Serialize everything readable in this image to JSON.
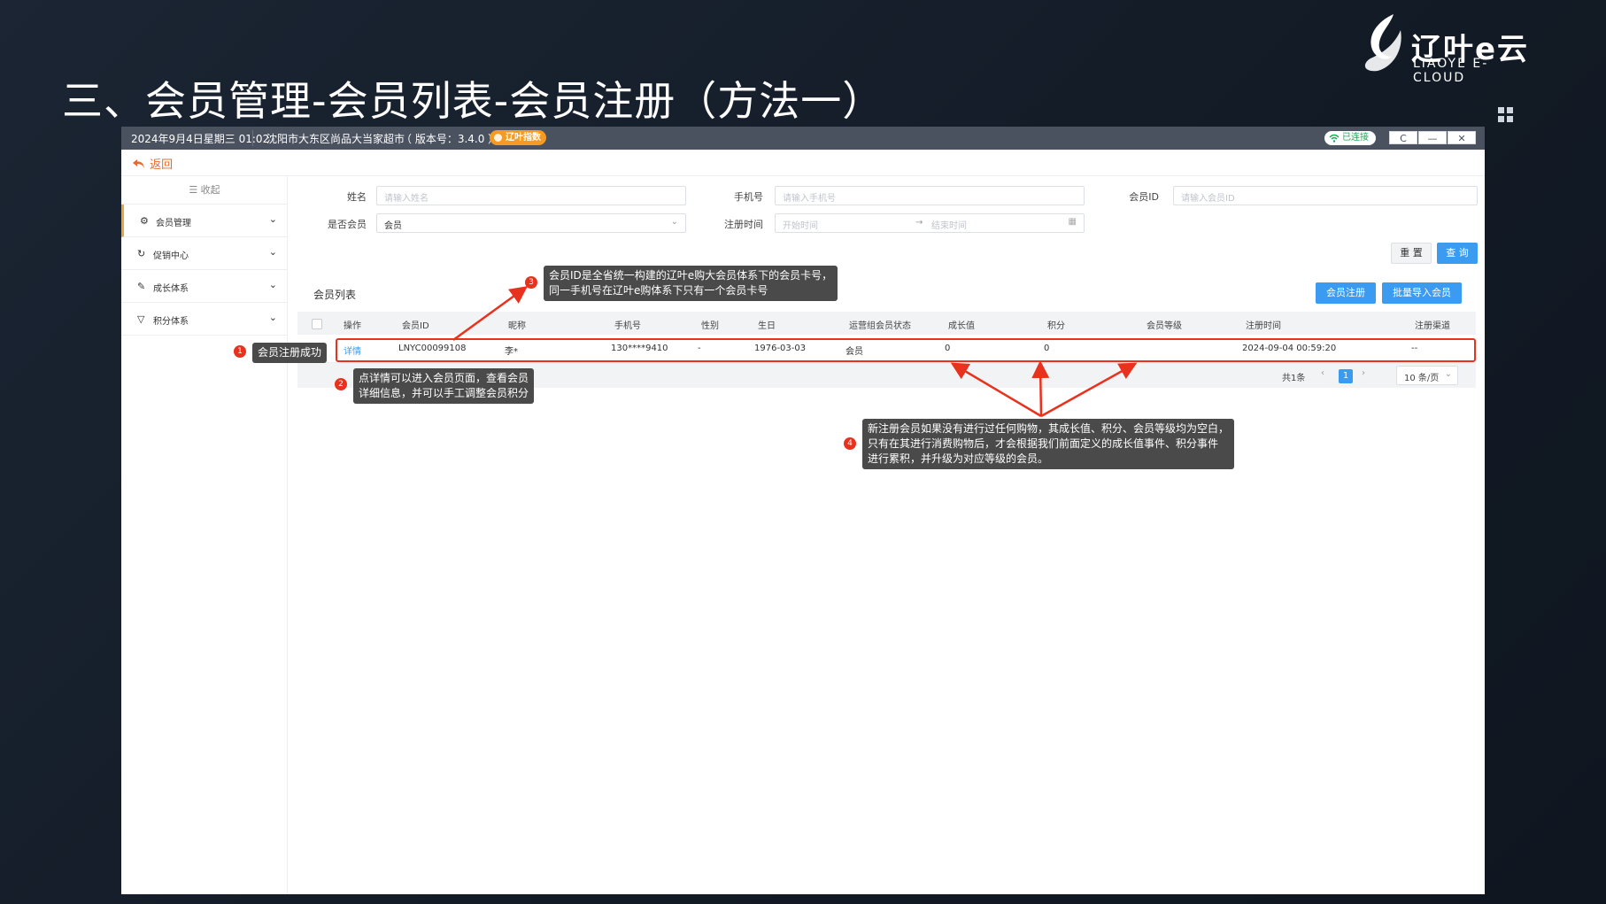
{
  "slide": {
    "title": "三、会员管理-会员列表-会员注册（方法一）",
    "logo_name": "辽叶e云",
    "logo_sub": "LIAOYE E-CLOUD"
  },
  "titlebar": {
    "datetime": "2024年9月4日星期三 01:02",
    "store": "沈阳市大东区尚品大当家超市",
    "version": "（ 版本号：3.4.0 ）",
    "brand_badge": "辽叶指数",
    "connection": "已连接",
    "btn_refresh": "C",
    "btn_minimize": "—",
    "btn_close": "✕"
  },
  "back": {
    "label": "返回"
  },
  "sidebar": {
    "collapse_label": "收起",
    "items": [
      {
        "label": "会员管理",
        "icon": "gear-icon"
      },
      {
        "label": "促销中心",
        "icon": "refresh-icon"
      },
      {
        "label": "成长体系",
        "icon": "tag-icon"
      },
      {
        "label": "积分体系",
        "icon": "filter-icon"
      }
    ]
  },
  "filters": {
    "name_label": "姓名",
    "name_placeholder": "请输入姓名",
    "phone_label": "手机号",
    "phone_placeholder": "请输入手机号",
    "member_id_label": "会员ID",
    "member_id_placeholder": "请输入会员ID",
    "is_member_label": "是否会员",
    "is_member_value": "会员",
    "reg_time_label": "注册时间",
    "start_placeholder": "开始时间",
    "end_placeholder": "结束时间"
  },
  "actions": {
    "reset": "重 置",
    "search": "查 询",
    "register": "会员注册",
    "batch_import": "批量导入会员"
  },
  "list": {
    "title": "会员列表",
    "columns": [
      "操作",
      "会员ID",
      "昵称",
      "手机号",
      "性别",
      "生日",
      "运营组会员状态",
      "成长值",
      "积分",
      "会员等级",
      "注册时间",
      "注册渠道"
    ],
    "rows": [
      {
        "action": "详情",
        "member_id": "LNYC00099108",
        "nickname": "李*",
        "phone": "130****9410",
        "gender": "-",
        "birthday": "1976-03-03",
        "status": "会员",
        "growth": "0",
        "points": "0",
        "level": "",
        "reg_time": "2024-09-04 00:59:20",
        "channel": "--"
      }
    ],
    "total": "共1条",
    "current_page": "1",
    "page_size": "10 条/页"
  },
  "callouts": {
    "c1_num": "1",
    "c1_text": "会员注册成功",
    "c2_num": "2",
    "c2_line1": "点详情可以进入会员页面，查看会员",
    "c2_line2": "详细信息，并可以手工调整会员积分",
    "c3_num": "3",
    "c3_line1": "会员ID是全省统一构建的辽叶e购大会员体系下的会员卡号，",
    "c3_line2": "同一手机号在辽叶e购体系下只有一个会员卡号",
    "c4_num": "4",
    "c4_line1": "新注册会员如果没有进行过任何购物，其成长值、积分、会员等级均为空白，",
    "c4_line2": "只有在其进行消费购物后，才会根据我们前面定义的成长值事件、积分事件",
    "c4_line3": "进行累积，并升级为对应等级的会员。"
  },
  "colors": {
    "accent": "#3a9bf0",
    "highlight": "#e8321e",
    "back_link": "#e8692d",
    "connected": "#1aaa55"
  }
}
